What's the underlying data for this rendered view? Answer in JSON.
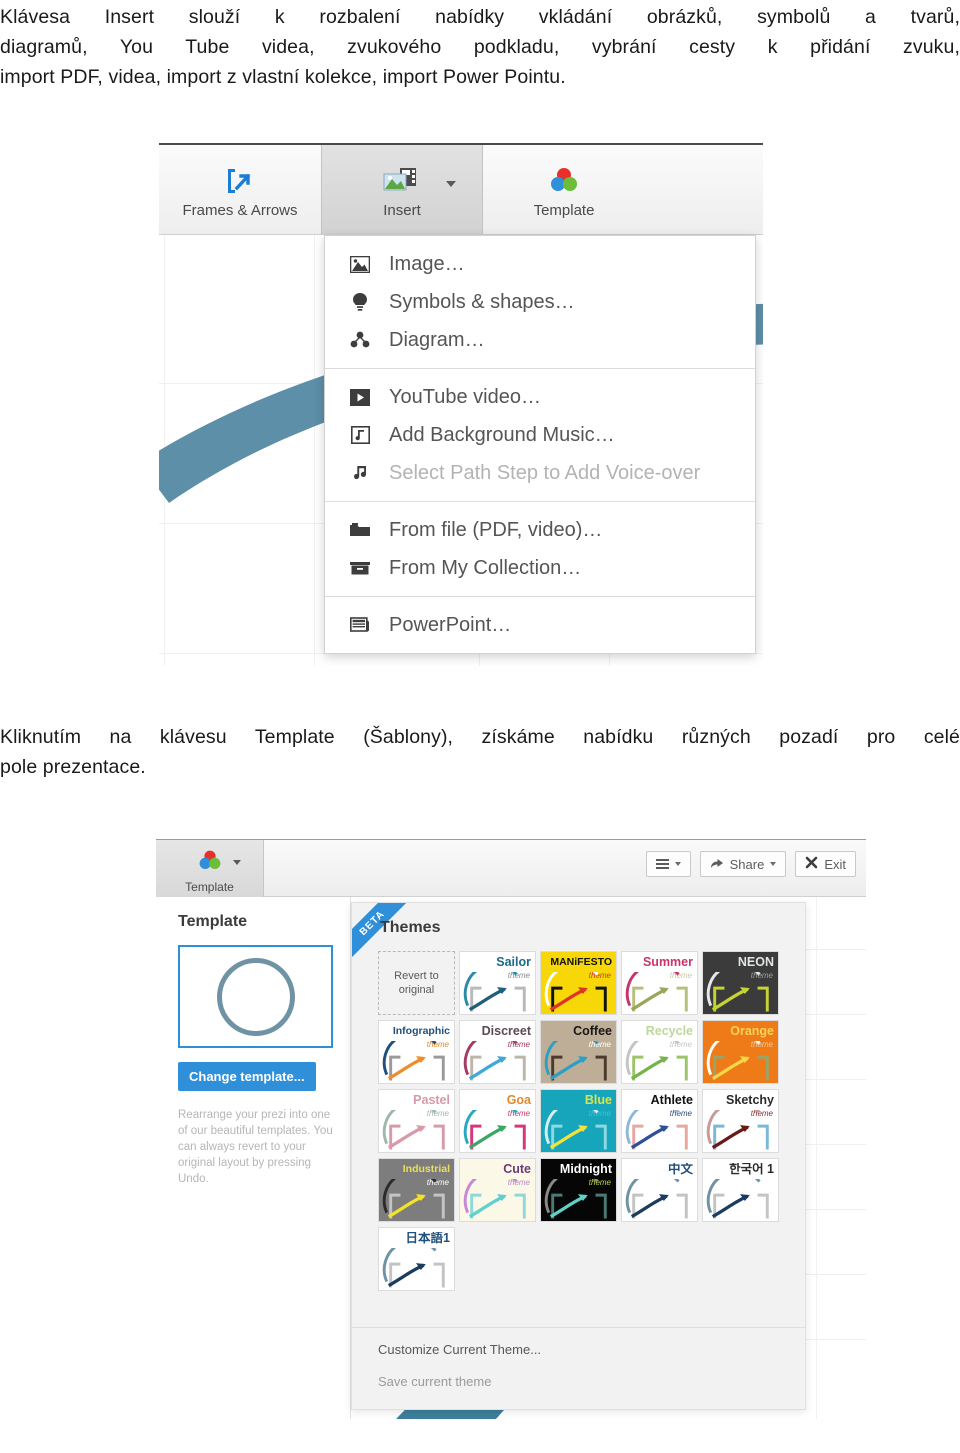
{
  "document": {
    "paragraph_top": [
      "Klávesa Insert slouží k rozbalení nabídky vkládání obrázků, symbolů a tvarů,",
      "diagramů, You Tube videa, zvukového podkladu, vybrání cesty k přidání zvuku,",
      "import PDF, videa, import z vlastní kolekce, import Power Pointu."
    ],
    "paragraph_middle": [
      "Kliknutím na klávesu Template (Šablony), získáme nabídku různých pozadí pro celé",
      "pole prezentace."
    ]
  },
  "insert_screenshot": {
    "toolbar": {
      "items": [
        {
          "label": "Frames & Arrows",
          "icon": "frames-and-arrows-icon",
          "active": false,
          "has_caret": false
        },
        {
          "label": "Insert",
          "icon": "insert-image-icon",
          "active": true,
          "has_caret": true
        },
        {
          "label": "Template",
          "icon": "template-circles-icon",
          "active": false,
          "has_caret": false
        }
      ]
    },
    "menu": {
      "groups": [
        {
          "items": [
            {
              "label": "Image…",
              "icon": "image-icon",
              "disabled": false
            },
            {
              "label": "Symbols & shapes…",
              "icon": "lightbulb-icon",
              "disabled": false
            },
            {
              "label": "Diagram…",
              "icon": "diagram-icon",
              "disabled": false
            }
          ]
        },
        {
          "items": [
            {
              "label": "YouTube video…",
              "icon": "play-icon",
              "disabled": false
            },
            {
              "label": "Add Background Music…",
              "icon": "music-file-icon",
              "disabled": false
            },
            {
              "label": "Select Path Step to Add Voice-over",
              "icon": "music-note-icon",
              "disabled": true
            }
          ]
        },
        {
          "items": [
            {
              "label": "From file (PDF, video)…",
              "icon": "folder-icon",
              "disabled": false
            },
            {
              "label": "From My Collection…",
              "icon": "archive-box-icon",
              "disabled": false
            }
          ]
        },
        {
          "items": [
            {
              "label": "PowerPoint…",
              "icon": "slides-icon",
              "disabled": false
            }
          ]
        }
      ]
    }
  },
  "template_screenshot": {
    "top_bar": {
      "template_button": {
        "label": "Template",
        "icon": "template-circles-icon"
      },
      "menu_button": {
        "icon": "hamburger-icon"
      },
      "share_button": {
        "label": "Share",
        "icon": "share-icon"
      },
      "exit_button": {
        "label": "Exit",
        "icon": "close-x-icon"
      }
    },
    "template_panel": {
      "title": "Template",
      "preview_icon": "circle-template-preview",
      "change_button": "Change template...",
      "description": "Rearrange your prezi into one of our beautiful templates. You can always revert to your original layout by pressing Undo."
    },
    "themes_panel": {
      "ribbon": "BETA",
      "title": "Themes",
      "revert_tile": "Revert to original",
      "themes": [
        {
          "name": "Sailor",
          "sub": "theme",
          "bg": "#ffffff",
          "name_color": "#1c6a8a",
          "sub_color": "#8a8a8a",
          "arrow": "#1f5f7c",
          "arc": "#2a8aa8",
          "bracket": "#b9b9b9"
        },
        {
          "name": "MANiFESTO",
          "sub": "theme",
          "bg": "#f7d708",
          "name_color": "#111111",
          "sub_color": "#d8342a",
          "arrow": "#e03326",
          "arc": "#ffffff",
          "bracket": "#111111"
        },
        {
          "name": "Summer",
          "sub": "theme",
          "bg": "#ffffff",
          "name_color": "#c8356b",
          "sub_color": "#c9c9a0",
          "arrow": "#9aa659",
          "arc": "#c8356b",
          "bracket": "#b7c07a"
        },
        {
          "name": "NEON",
          "sub": "theme",
          "bg": "#3b3b3b",
          "name_color": "#dfe7e3",
          "sub_color": "#9aa29c",
          "arrow": "#c5d430",
          "arc": "#e8e8e8",
          "bracket": "#c5d430"
        },
        {
          "name": "Infographic",
          "sub": "theme",
          "bg": "#ffffff",
          "name_color": "#1f4f7a",
          "sub_color": "#e08a2a",
          "arrow": "#ef8d2b",
          "arc": "#1f4f7a",
          "bracket": "#9a9a9a"
        },
        {
          "name": "Discreet",
          "sub": "theme",
          "bg": "#ffffff",
          "name_color": "#5a4a55",
          "sub_color": "#a63a62",
          "arrow": "#3fa8d8",
          "arc": "#a63a62",
          "bracket": "#bdb6a8"
        },
        {
          "name": "Coffee",
          "sub": "theme",
          "bg": "#bfae97",
          "name_color": "#171717",
          "sub_color": "#ffffff",
          "arrow": "#2e9fc4",
          "arc": "#2e9fc4",
          "bracket": "#4a3b2c"
        },
        {
          "name": "Recycle",
          "sub": "theme",
          "bg": "#ffffff",
          "name_color": "#bcd89a",
          "sub_color": "#c8c8c8",
          "arrow": "#77b24a",
          "arc": "#c4c4c4",
          "bracket": "#9cc46a"
        },
        {
          "name": "Orange",
          "sub": "theme",
          "bg": "#ef7b18",
          "name_color": "#f6d35a",
          "sub_color": "#f6c9a0",
          "arrow": "#f7d64a",
          "arc": "#ffffff",
          "bracket": "#9aa36a"
        },
        {
          "name": "Pastel",
          "sub": "theme",
          "bg": "#ffffff",
          "name_color": "#d99aa8",
          "sub_color": "#9fb8ae",
          "arrow": "#d99aa8",
          "arc": "#9fb8ae",
          "bracket": "#d99aa8"
        },
        {
          "name": "Goa",
          "sub": "theme",
          "bg": "#ffffff",
          "name_color": "#e08a2a",
          "sub_color": "#c8356b",
          "arrow": "#3aa864",
          "arc": "#2aa8c0",
          "bracket": "#d8357a"
        },
        {
          "name": "Blue",
          "sub": "theme",
          "bg": "#17a5bb",
          "name_color": "#d6e64a",
          "sub_color": "#3fc0d4",
          "arrow": "#f2e23a",
          "arc": "#d8eef2",
          "bracket": "#8fd8e2"
        },
        {
          "name": "Athlete",
          "sub": "theme",
          "bg": "#ffffff",
          "name_color": "#111111",
          "sub_color": "#2a4a7a",
          "arrow": "#2f4f9a",
          "arc": "#8fb8d8",
          "bracket": "#e8a8a0"
        },
        {
          "name": "Sketchy",
          "sub": "theme",
          "bg": "#ffffff",
          "name_color": "#2b2b2b",
          "sub_color": "#8a2a2a",
          "arrow": "#6a1818",
          "arc": "#c49a9a",
          "bracket": "#7ab8d8"
        },
        {
          "name": "Industrial",
          "sub": "theme",
          "bg": "#7d7d7d",
          "name_color": "#e8e05a",
          "sub_color": "#ffffff",
          "arrow": "#f2e22a",
          "arc": "#2b2b2b",
          "bracket": "#c4c4c4"
        },
        {
          "name": "Cute",
          "sub": "theme",
          "bg": "#fbf8e8",
          "name_color": "#6a3a7a",
          "sub_color": "#b98ac4",
          "arrow": "#5fd0d0",
          "arc": "#c48ad4",
          "bracket": "#8fd8d8"
        },
        {
          "name": "Midnight",
          "sub": "theme",
          "bg": "#060606",
          "name_color": "#ffffff",
          "sub_color": "#b8d83a",
          "arrow": "#5fd0c4",
          "arc": "#8a8a8a",
          "bracket": "#4a7a74"
        },
        {
          "name": "中文",
          "sub": "",
          "bg": "#ffffff",
          "name_color": "#1f4f7a",
          "sub_color": "#8a8a8a",
          "arrow": "#1b3c5e",
          "arc": "#6f93a5",
          "bracket": "#c4c4c4"
        },
        {
          "name": "한국어 1",
          "sub": "",
          "bg": "#ffffff",
          "name_color": "#2b2b2b",
          "sub_color": "#8a8a8a",
          "arrow": "#1b3c5e",
          "arc": "#6f93a5",
          "bracket": "#c4c4c4"
        },
        {
          "name": "日本語1",
          "sub": "",
          "bg": "#ffffff",
          "name_color": "#1f4f7a",
          "sub_color": "#8a8a8a",
          "arrow": "#1b3c5e",
          "arc": "#6f93a5",
          "bracket": "#c4c4c4"
        }
      ],
      "footer": {
        "customize_link": "Customize Current Theme...",
        "save_link": "Save current theme"
      }
    }
  },
  "colors": {
    "accent_blue": "#2f8fd8",
    "swoosh": "#5e8fa8",
    "toolbar_gray": "#eeeeee"
  }
}
